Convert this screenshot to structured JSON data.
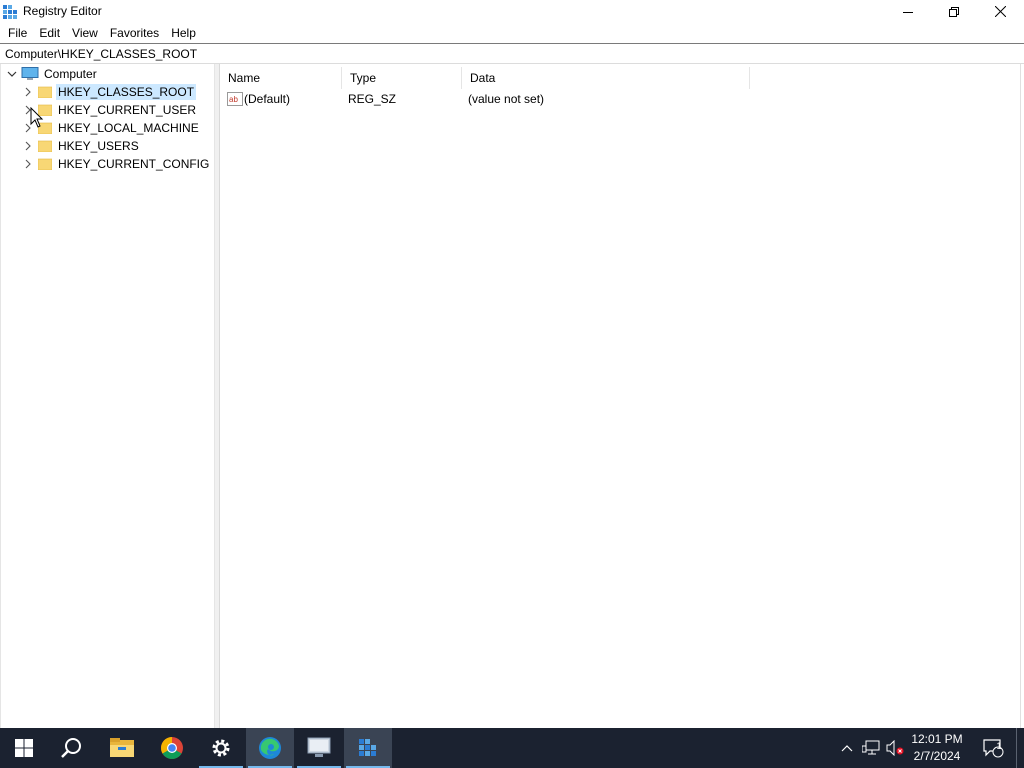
{
  "window": {
    "title": "Registry Editor"
  },
  "menu": [
    "File",
    "Edit",
    "View",
    "Favorites",
    "Help"
  ],
  "address": "Computer\\HKEY_CLASSES_ROOT",
  "tree": {
    "root": "Computer",
    "keys": [
      "HKEY_CLASSES_ROOT",
      "HKEY_CURRENT_USER",
      "HKEY_LOCAL_MACHINE",
      "HKEY_USERS",
      "HKEY_CURRENT_CONFIG"
    ],
    "selected_index": 0
  },
  "list": {
    "columns": [
      "Name",
      "Type",
      "Data"
    ],
    "rows": [
      {
        "name": "(Default)",
        "type": "REG_SZ",
        "data": "(value not set)"
      }
    ]
  },
  "taskbar": {
    "time": "12:01 PM",
    "date": "2/7/2024",
    "notification_count": "1"
  },
  "colors": {
    "taskbar": "#1b2230",
    "selection": "#cce8ff",
    "accent": "#76b9ed"
  }
}
